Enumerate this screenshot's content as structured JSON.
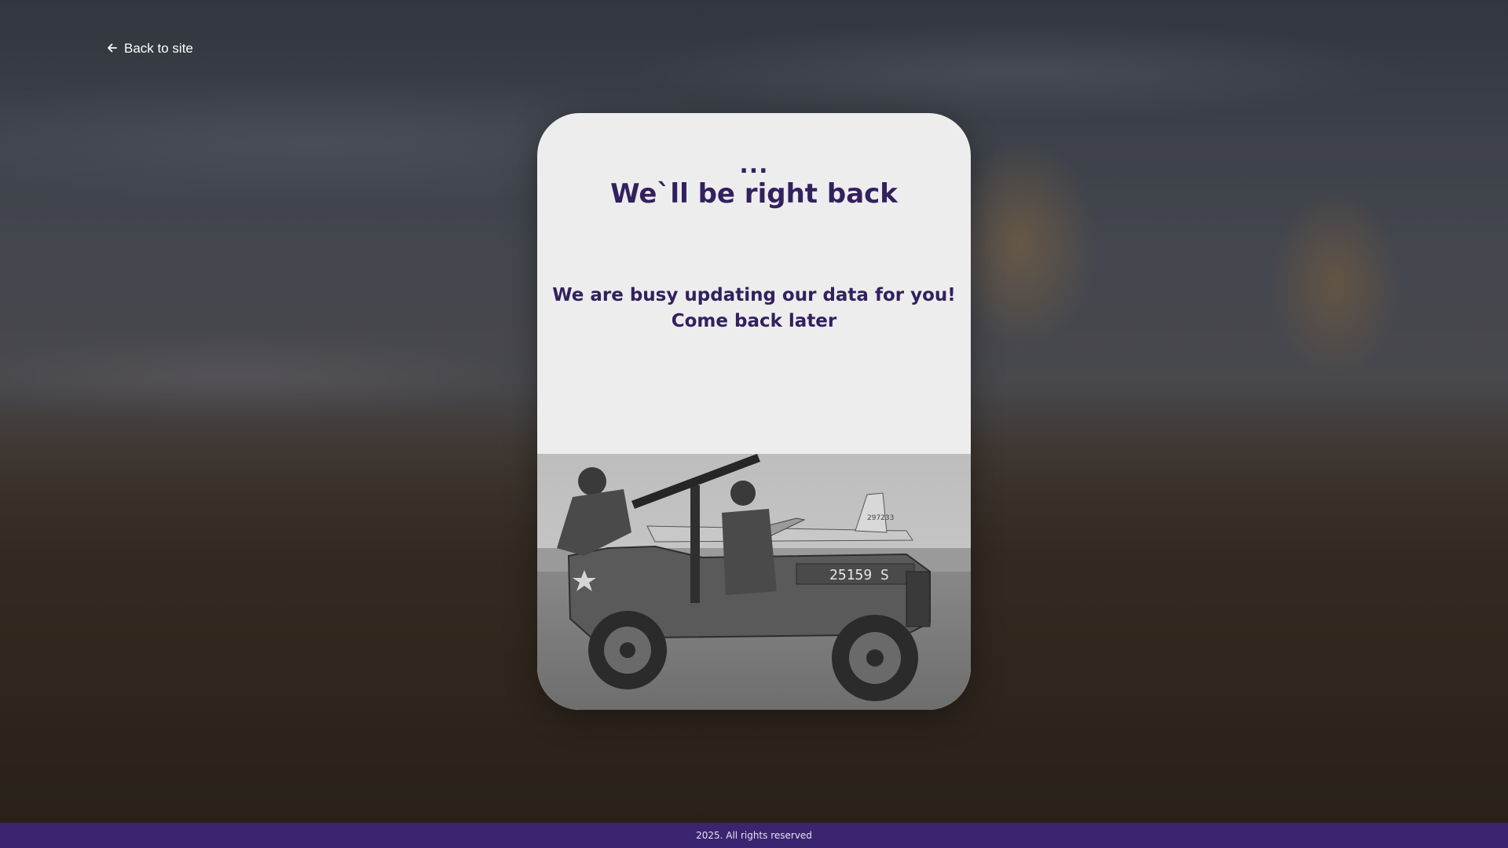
{
  "nav": {
    "back_label": "Back to site",
    "back_icon": "arrow-left-icon"
  },
  "card": {
    "ellipsis": "...",
    "title": "We`ll be right back",
    "message_line1": "We are busy updating our data for you!",
    "message_line2": "Come back later",
    "image_plate_text": "25159 S",
    "image_tail_code": "297233"
  },
  "footer": {
    "text": "2025. All rights reserved"
  },
  "colors": {
    "accent": "#33205e",
    "footer_bg": "#3b2470",
    "card_bg": "#ededee"
  }
}
